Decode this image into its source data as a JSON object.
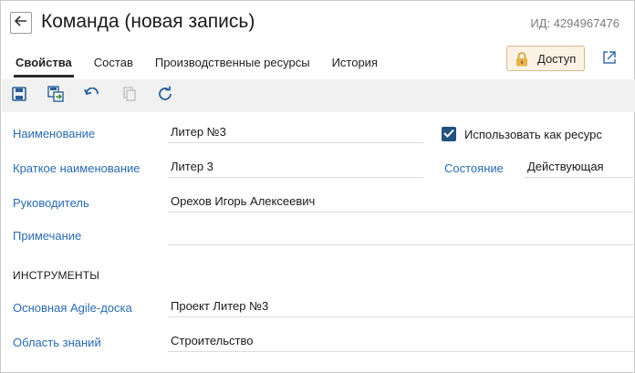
{
  "header": {
    "title": "Команда (новая запись)",
    "record_id": "ИД: 4294967476"
  },
  "tabs": [
    {
      "label": "Свойства",
      "active": true
    },
    {
      "label": "Состав",
      "active": false
    },
    {
      "label": "Производственные ресурсы",
      "active": false
    },
    {
      "label": "История",
      "active": false
    }
  ],
  "access_button": {
    "label": "Доступ",
    "icon": "lock-icon"
  },
  "toolbar": {
    "icons": [
      "save-icon",
      "save-and-close-icon",
      "undo-icon",
      "copy-icon",
      "refresh-icon"
    ]
  },
  "form": {
    "name": {
      "label": "Наименование",
      "value": "Литер №3"
    },
    "use_as_resource": {
      "label": "Использовать как ресурс",
      "checked": true
    },
    "short_name": {
      "label": "Краткое наименование",
      "value": "Литер 3"
    },
    "state": {
      "label": "Состояние",
      "value": "Действующая"
    },
    "manager": {
      "label": "Руководитель",
      "value": "Орехов Игорь Алексеевич"
    },
    "note": {
      "label": "Примечание",
      "value": ""
    },
    "tools_section": "ИНСТРУМЕНТЫ",
    "agile_board": {
      "label": "Основная Agile-доска",
      "value": "Проект Литер №3"
    },
    "knowledge_area": {
      "label": "Область знаний",
      "value": "Строительство"
    }
  },
  "colors": {
    "label_blue": "#2a6bb0",
    "checkbox_fill": "#22527e",
    "access_bg": "#fbf2e3",
    "toolbar_bg": "#f1f1f1"
  }
}
